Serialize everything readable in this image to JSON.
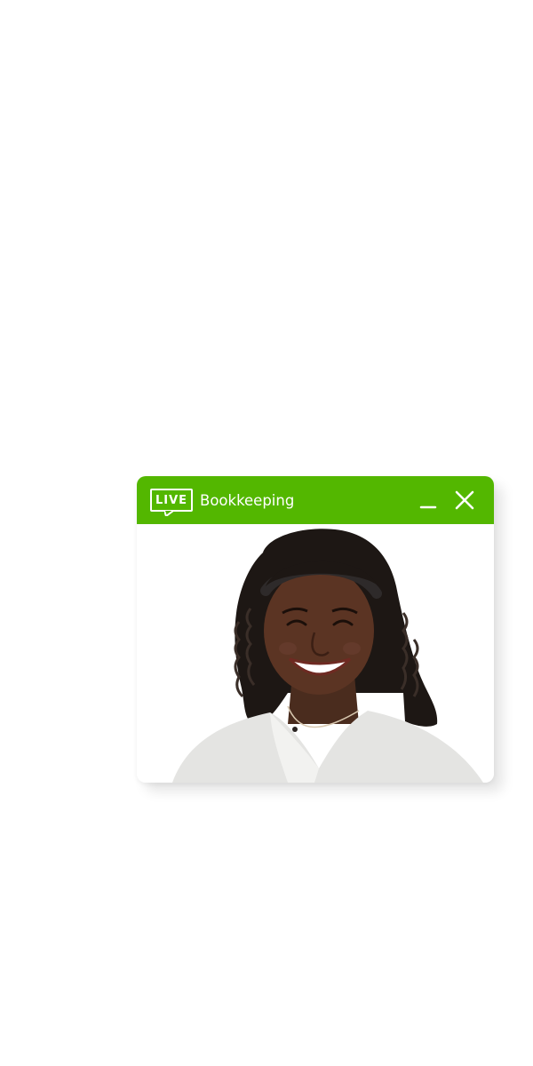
{
  "widget": {
    "badge_label": "LIVE",
    "title": "Bookkeeping",
    "accent_color": "#53b700",
    "minimize_icon": "minimize-icon",
    "close_icon": "close-icon",
    "photo_subject": "smiling woman with curly dark hair in light gray top"
  }
}
